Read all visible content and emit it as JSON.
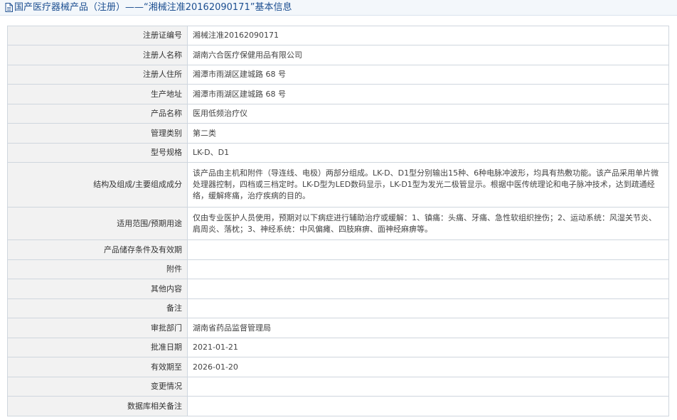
{
  "page": {
    "title": "国产医疗器械产品（注册）——“湘械注准20162090171”基本信息",
    "title_icon": "document-icon",
    "accent_color": "#1d4f91"
  },
  "rows": [
    {
      "label": "注册证编号",
      "value": "湘械注准20162090171"
    },
    {
      "label": "注册人名称",
      "value": "湖南六合医疗保健用品有限公司"
    },
    {
      "label": "注册人住所",
      "value": "湘潭市雨湖区建城路 68 号"
    },
    {
      "label": "生产地址",
      "value": "湘潭市雨湖区建城路 68 号"
    },
    {
      "label": "产品名称",
      "value": "医用低频治疗仪"
    },
    {
      "label": "管理类别",
      "value": "第二类"
    },
    {
      "label": "型号规格",
      "value": "LK-D、D1"
    },
    {
      "label": "结构及组成/主要组成成分",
      "value": "该产品由主机和附件（导连线、电极）两部分组成。LK-D、D1型分别输出15种、6种电脉冲波形，均具有热敷功能。该产品采用单片微处理器控制，四档或三档定时。LK-D型为LED数码显示，LK-D1型为发光二极管显示。根据中医传统理论和电子脉冲技术，达到疏通经络，缓解疼痛，治疗疾病的目的。"
    },
    {
      "label": "适用范围/预期用途",
      "value": "仅由专业医护人员使用，预期对以下病症进行辅助治疗或缓解：1、镇痛：头痛、牙痛、急性软组织挫伤；2、运动系统：风湿关节炎、肩周炎、落枕；3、神经系统：中风偏瘫、四肢麻痹、面神经麻痹等。"
    },
    {
      "label": "产品储存条件及有效期",
      "value": ""
    },
    {
      "label": "附件",
      "value": ""
    },
    {
      "label": "其他内容",
      "value": ""
    },
    {
      "label": "备注",
      "value": ""
    },
    {
      "label": "审批部门",
      "value": "湖南省药品监督管理局"
    },
    {
      "label": "批准日期",
      "value": "2021-01-21"
    },
    {
      "label": "有效期至",
      "value": "2026-01-20"
    },
    {
      "label": "变更情况",
      "value": ""
    },
    {
      "label": "数据库相关备注",
      "value": ""
    }
  ]
}
